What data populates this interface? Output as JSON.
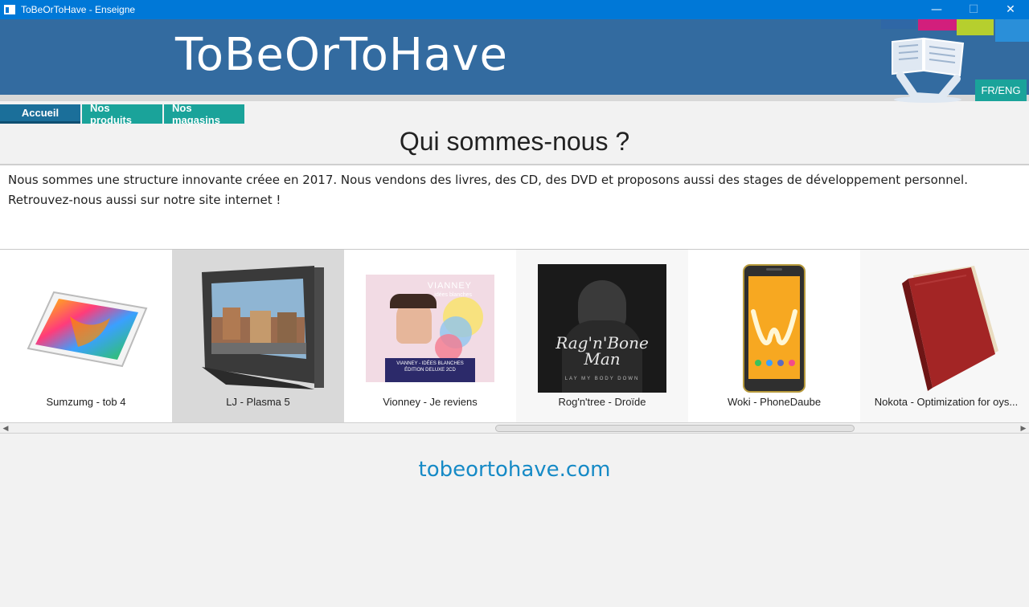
{
  "window": {
    "title": "ToBeOrToHave - Enseigne",
    "minimize": "—",
    "maximize": "☐",
    "close": "✕"
  },
  "banner": {
    "title": "ToBeOrToHave",
    "lang_button": "FR/ENG"
  },
  "nav": {
    "items": [
      {
        "label": "Accueil"
      },
      {
        "label": "Nos produits"
      },
      {
        "label": "Nos magasins"
      }
    ]
  },
  "main": {
    "heading": "Qui sommes-nous ?",
    "description_line1": "Nous sommes une structure innovante créee en 2017. Nous vendons des livres, des CD, des DVD et proposons aussi des stages de développement personnel.",
    "description_line2": "Retrouvez-nous aussi sur notre site internet !"
  },
  "products": [
    {
      "caption": "Sumzumg -  tob 4",
      "icon": "tablet-icon"
    },
    {
      "caption": "LJ -  Plasma 5",
      "icon": "television-icon"
    },
    {
      "caption": "Vionney -  Je reviens",
      "icon": "album-cover-icon",
      "cover_title": "VIANNEY",
      "cover_subtitle": "idées blanches",
      "cover_band": "VIANNEY - IDÉES BLANCHES",
      "cover_band2": "ÉDITION DELUXE 2CD"
    },
    {
      "caption": "Rog'n'tree -  Droïde",
      "icon": "album-cover-icon",
      "cover_title": "Rag'n'Bone Man",
      "cover_subtitle": "LAY MY BODY DOWN"
    },
    {
      "caption": "Woki -  PhoneDaube",
      "icon": "smartphone-icon"
    },
    {
      "caption": "Nokota -  Optimization for oys...",
      "icon": "book-icon"
    }
  ],
  "footer": {
    "site": "tobeortohave.com"
  },
  "colors": {
    "titlebar": "#0078d7",
    "banner": "#336ba0",
    "nav_active": "#1b6f9a",
    "nav_teal": "#1aa39a",
    "link": "#168ac6"
  }
}
